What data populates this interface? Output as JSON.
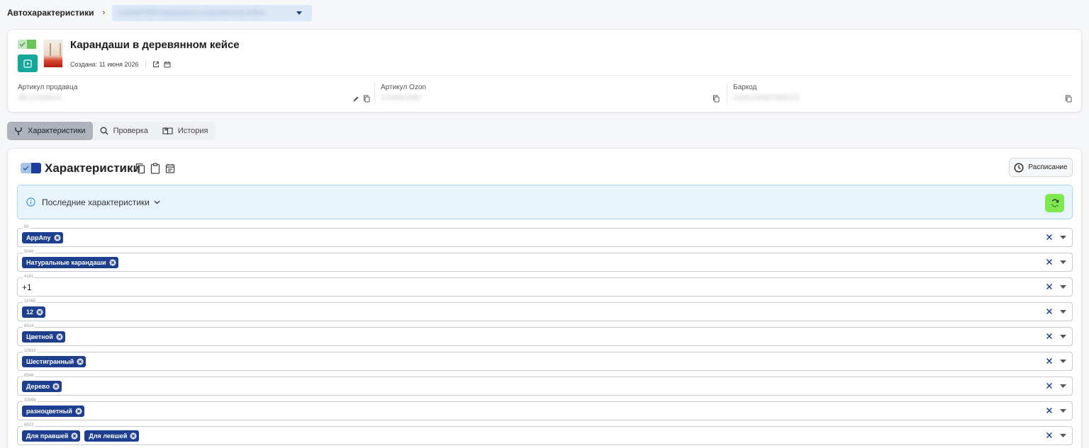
{
  "breadcrumb": {
    "root": "Автохарактеристики",
    "separator": "›",
    "select_value": "1234567890 Карандаши в деревянном кейсе"
  },
  "product": {
    "title": "Карандаши в деревянном кейсе",
    "created": "Создана: 11 июня 2026",
    "fields": [
      {
        "label": "Артикул продавца",
        "value": "AB-12345678"
      },
      {
        "label": "Артикул Ozon",
        "value": "1234567890"
      },
      {
        "label": "Баркод",
        "value": "OZN1234567890123"
      }
    ]
  },
  "tabs": [
    {
      "label": "Характеристики",
      "icon": "fork-icon",
      "active": true
    },
    {
      "label": "Проверка",
      "icon": "search-icon",
      "active": false
    },
    {
      "label": "История",
      "icon": "book-icon",
      "active": false
    }
  ],
  "characteristics": {
    "title": "Характеристики",
    "schedule_label": "Расписание",
    "latest_label": "Последние характеристики",
    "rows": [
      {
        "id": "85",
        "chips": [
          "AppAny"
        ]
      },
      {
        "id": "9048",
        "chips": [
          "Натуральные карандаши"
        ]
      },
      {
        "id": "4191",
        "text": "+1"
      },
      {
        "id": "11065",
        "chips": [
          "12"
        ]
      },
      {
        "id": "6514",
        "chips": [
          "Цветной"
        ]
      },
      {
        "id": "10815",
        "chips": [
          "Шестигранный"
        ]
      },
      {
        "id": "6548",
        "chips": [
          "Дерево"
        ]
      },
      {
        "id": "10096",
        "chips": [
          "разноцветный"
        ]
      },
      {
        "id": "6522",
        "chips": [
          "Для правшей",
          "Для левшей"
        ]
      }
    ]
  },
  "colors": {
    "accent_teal": "#14a79a",
    "chip_blue": "#1e3f8f",
    "refresh_green": "#7ee84e",
    "info_bg": "#e7f4fc"
  }
}
